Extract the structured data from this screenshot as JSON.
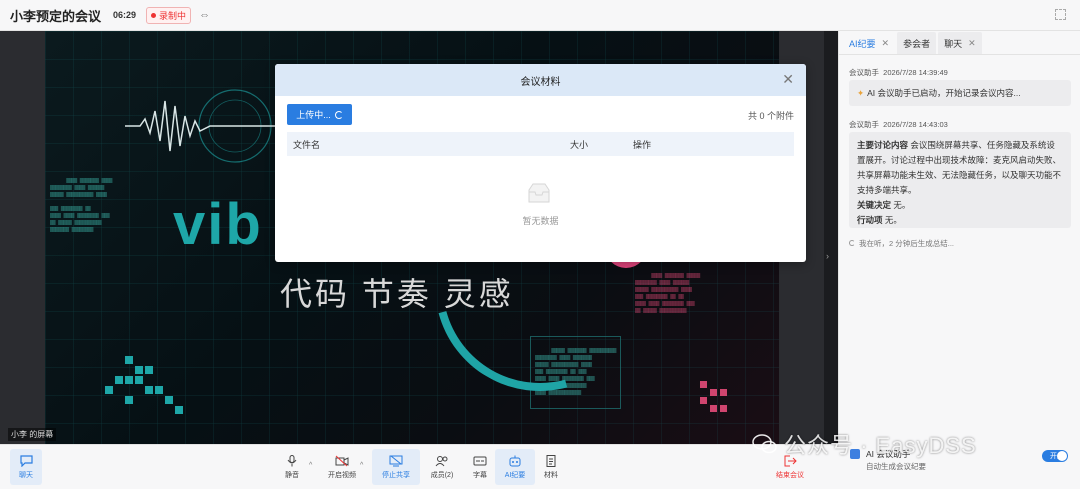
{
  "header": {
    "title": "小李预定的会议",
    "duration": "06:29",
    "recording_label": "录制中"
  },
  "screen_share": {
    "owner_label": "小李 的屏幕",
    "big_text": "vib",
    "slogan": "代码   节奏   灵感"
  },
  "modal": {
    "title": "会议材料",
    "upload_label": "上传中...",
    "attachment_count": "共 0 个附件",
    "columns": [
      "文件名",
      "大小",
      "操作"
    ],
    "empty_text": "暂无数据"
  },
  "right_panel": {
    "tabs": [
      {
        "label": "AI纪要",
        "closable": true
      },
      {
        "label": "参会者",
        "closable": false
      },
      {
        "label": "聊天",
        "closable": true
      }
    ],
    "messages": [
      {
        "sender": "会议助手",
        "time": "2026/7/28 14:39:49",
        "text": "AI 会议助手已启动，开始记录会议内容..."
      },
      {
        "sender": "会议助手",
        "time": "2026/7/28 14:43:03",
        "summary_label": "主要讨论内容",
        "summary_text": "会议围绕屏幕共享、任务隐藏及系统设置展开。讨论过程中出现技术故障：麦克风启动失败、共享屏幕功能未生效、无法隐藏任务，以及聊天功能不支持多端共享。",
        "decision_label": "关键决定",
        "decision_text": "无。",
        "action_label": "行动项",
        "action_text": "无。"
      }
    ],
    "listening_text": "我在听，2 分钟后生成总结...",
    "assistant": {
      "title": "AI 会议助手",
      "subtitle": "自动生成会议纪要",
      "toggle_label": "开启"
    }
  },
  "toolbar": {
    "chat_label": "聊天",
    "buttons": [
      {
        "label": "静音",
        "icon": "microphone-icon"
      },
      {
        "label": "开启视频",
        "icon": "camera-off-icon"
      },
      {
        "label": "停止共享",
        "icon": "share-screen-icon"
      },
      {
        "label": "成员(2)",
        "icon": "members-icon"
      },
      {
        "label": "字幕",
        "icon": "subtitles-icon"
      },
      {
        "label": "AI纪要",
        "icon": "robot-icon"
      },
      {
        "label": "材料",
        "icon": "document-icon"
      }
    ],
    "end_label": "结束会议"
  },
  "watermark": {
    "text": "公众号 · EasyDSS"
  },
  "colors": {
    "accent": "#2a7de1",
    "danger": "#e33333",
    "teal": "#1ea7a8",
    "pink": "#e0457d"
  }
}
